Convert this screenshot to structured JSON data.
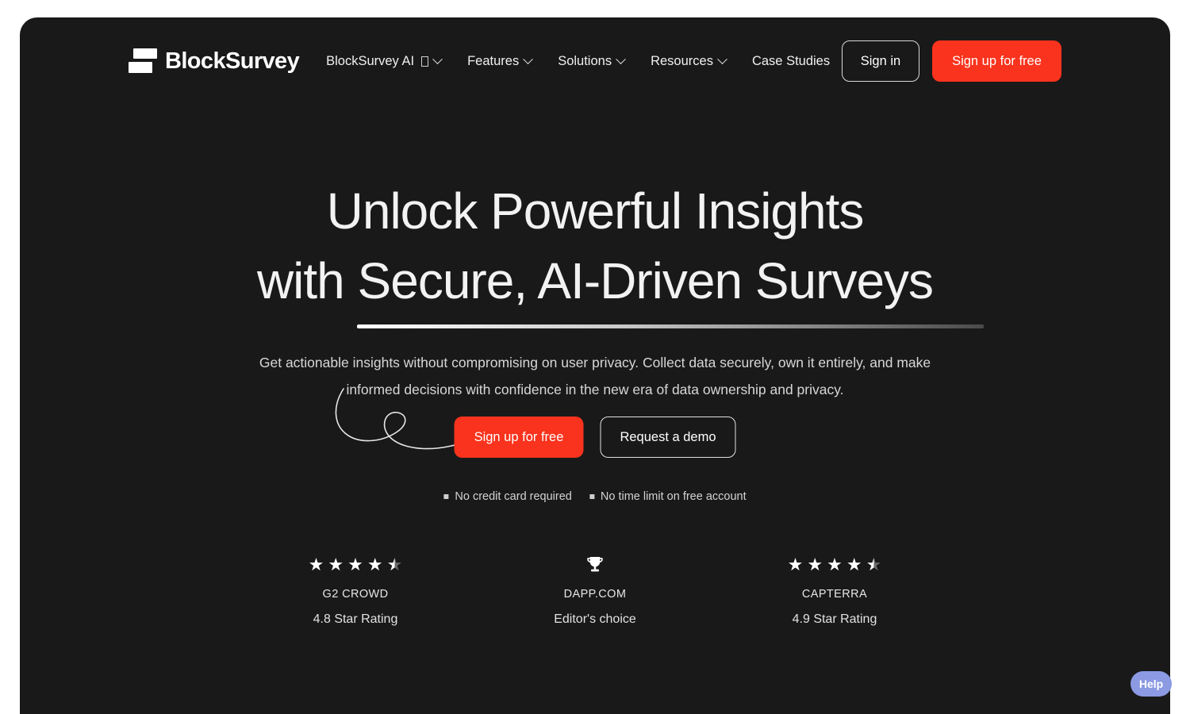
{
  "theme": {
    "page_background": "#ffffff",
    "panel_background": "#19191a",
    "accent_red": "#f9331d",
    "text_primary": "#f2f2f2",
    "text_secondary": "#d7d7d7",
    "help_background": "#8b9ae2"
  },
  "header": {
    "brand_name": "BlockSurvey",
    "nav": [
      {
        "label": "BlockSurvey AI",
        "has_glyph": true,
        "has_chevron": true
      },
      {
        "label": "Features",
        "has_glyph": false,
        "has_chevron": true
      },
      {
        "label": "Solutions",
        "has_glyph": false,
        "has_chevron": true
      },
      {
        "label": "Resources",
        "has_glyph": false,
        "has_chevron": true
      },
      {
        "label": "Case Studies",
        "has_glyph": false,
        "has_chevron": false
      }
    ],
    "sign_in_label": "Sign in",
    "sign_up_label": "Sign up for free"
  },
  "hero": {
    "headline_line1": "Unlock Powerful Insights",
    "headline_line2_prefix": "with ",
    "headline_line2_underlined": "Secure, AI-Driven Surveys",
    "subtitle_line1": "Get actionable insights without compromising on user privacy. Collect data securely, own it entirely,",
    "subtitle_line2": "and make informed decisions with confidence in the new era of data ownership and privacy.",
    "cta_primary": "Sign up for free",
    "cta_secondary": "Request a demo",
    "features": [
      "No credit card required",
      "No time limit on free account"
    ]
  },
  "ratings": [
    {
      "icon": "stars",
      "full_stars": 4,
      "half_star": true,
      "name": "G2 CROWD",
      "sub": "4.8 Star Rating"
    },
    {
      "icon": "trophy",
      "full_stars": 0,
      "half_star": false,
      "name": "DAPP.COM",
      "sub": "Editor's choice"
    },
    {
      "icon": "stars",
      "full_stars": 4,
      "half_star": true,
      "name": "CAPTERRA",
      "sub": "4.9 Star Rating"
    }
  ],
  "widget": {
    "help_label": "Help"
  }
}
